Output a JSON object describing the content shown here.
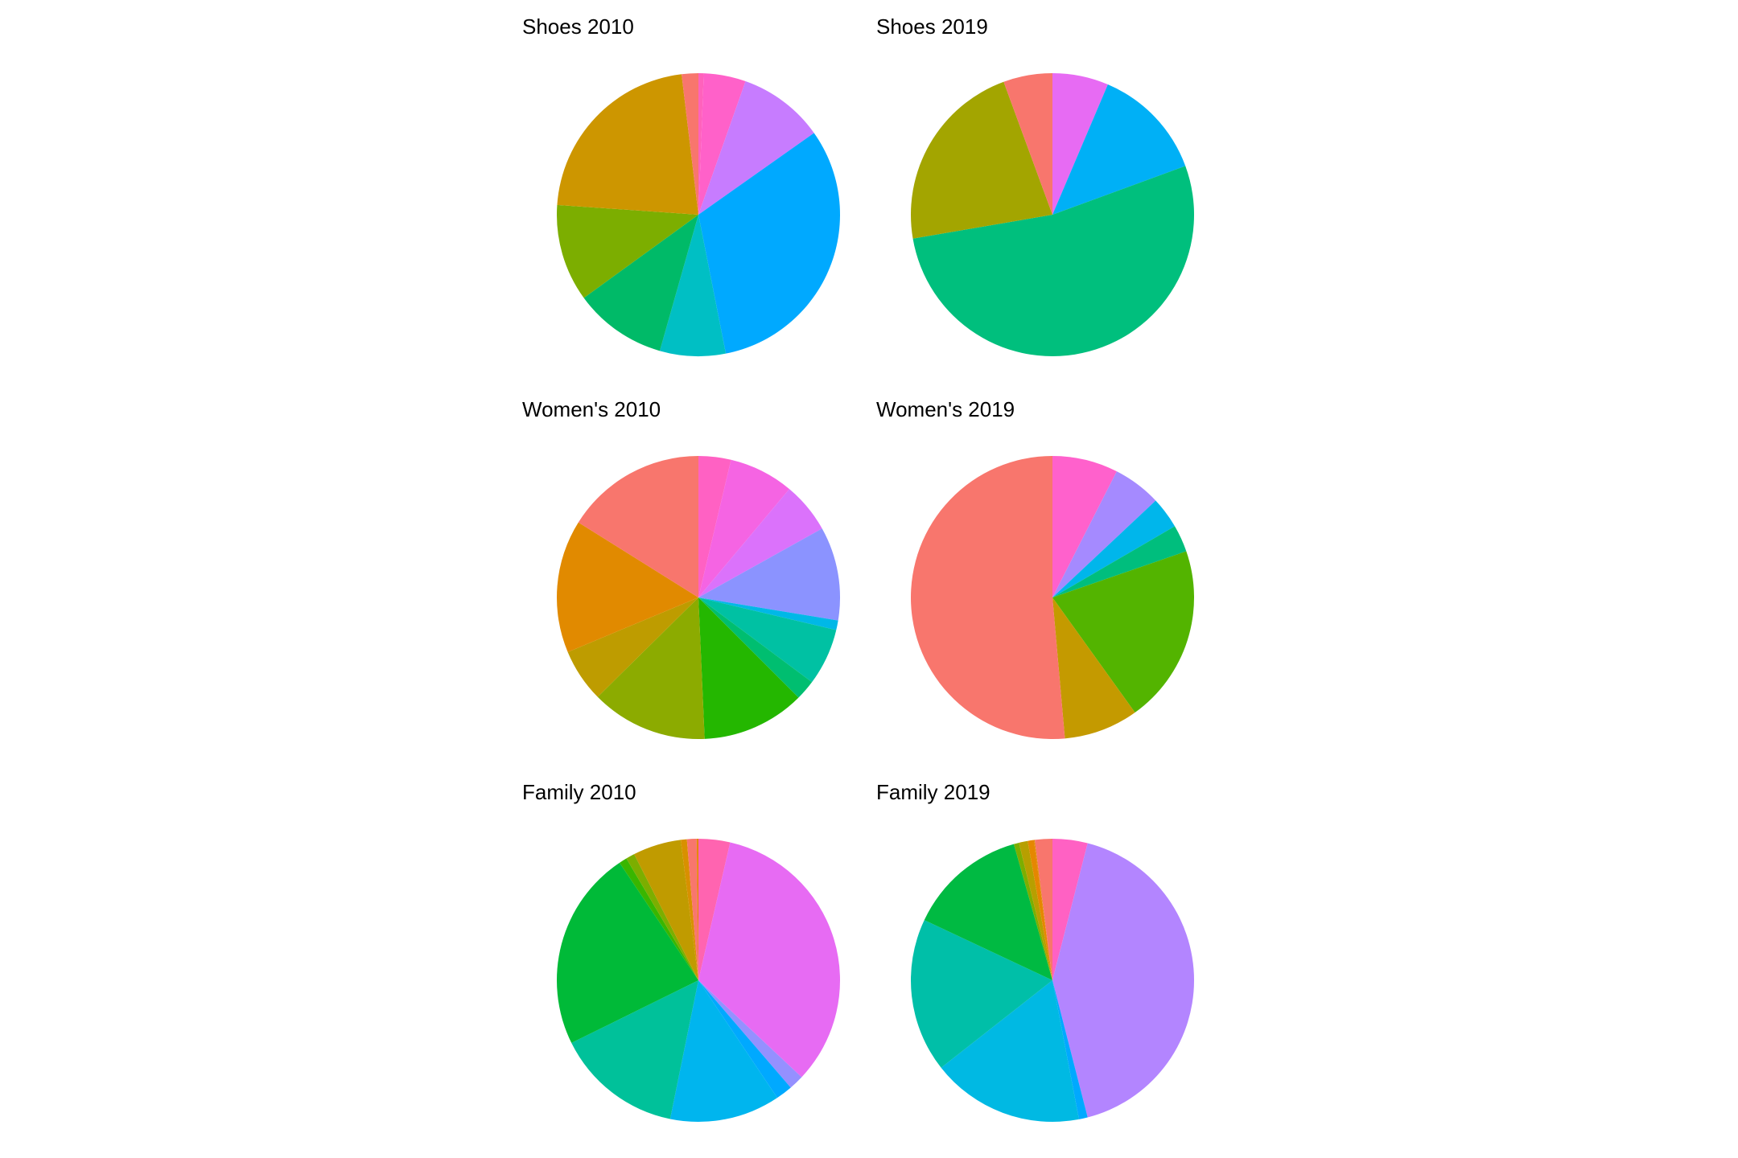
{
  "chart_data": [
    {
      "type": "pie",
      "title": "Shoes 2010",
      "slices": [
        {
          "value": 0.6,
          "color": "#FF62BC"
        },
        {
          "value": 4.8,
          "color": "#FF61C9"
        },
        {
          "value": 9.8,
          "color": "#C77CFF"
        },
        {
          "value": 31.7,
          "color": "#00A9FF"
        },
        {
          "value": 7.5,
          "color": "#00BFC4"
        },
        {
          "value": 10.6,
          "color": "#00BA68"
        },
        {
          "value": 11.1,
          "color": "#7CAE00"
        },
        {
          "value": 22.0,
          "color": "#CD9600"
        },
        {
          "value": 1.9,
          "color": "#F8766D"
        }
      ]
    },
    {
      "type": "pie",
      "title": "Shoes 2019",
      "slices": [
        {
          "value": 6.4,
          "color": "#E76BF3"
        },
        {
          "value": 13.0,
          "color": "#00B0F6"
        },
        {
          "value": 52.9,
          "color": "#00BF7D"
        },
        {
          "value": 22.1,
          "color": "#A3A500"
        },
        {
          "value": 5.6,
          "color": "#F8766D"
        }
      ]
    },
    {
      "type": "pie",
      "title": "Women's 2010",
      "slices": [
        {
          "value": 3.7,
          "color": "#FF61C3"
        },
        {
          "value": 7.4,
          "color": "#F564E3"
        },
        {
          "value": 5.8,
          "color": "#DB72FB"
        },
        {
          "value": 10.7,
          "color": "#8B93FF"
        },
        {
          "value": 1.1,
          "color": "#00B8E7"
        },
        {
          "value": 6.5,
          "color": "#00C1A3"
        },
        {
          "value": 2.3,
          "color": "#00BE70"
        },
        {
          "value": 11.8,
          "color": "#24B700"
        },
        {
          "value": 13.3,
          "color": "#8CAB00"
        },
        {
          "value": 6.1,
          "color": "#BE9C00"
        },
        {
          "value": 15.2,
          "color": "#E18A00"
        },
        {
          "value": 16.1,
          "color": "#F8766D"
        }
      ]
    },
    {
      "type": "pie",
      "title": "Women's 2019",
      "slices": [
        {
          "value": 7.5,
          "color": "#FF61CC"
        },
        {
          "value": 5.5,
          "color": "#A58AFF"
        },
        {
          "value": 3.6,
          "color": "#00B6EB"
        },
        {
          "value": 3.1,
          "color": "#00BE7D"
        },
        {
          "value": 20.4,
          "color": "#53B400"
        },
        {
          "value": 8.5,
          "color": "#C49A00"
        },
        {
          "value": 51.4,
          "color": "#F8766D"
        }
      ]
    },
    {
      "type": "pie",
      "title": "Family 2010",
      "slices": [
        {
          "value": 3.6,
          "color": "#FF64B0"
        },
        {
          "value": 33.4,
          "color": "#E76BF3"
        },
        {
          "value": 1.7,
          "color": "#9590FF"
        },
        {
          "value": 1.9,
          "color": "#00A9FF"
        },
        {
          "value": 12.6,
          "color": "#00B5EE"
        },
        {
          "value": 14.5,
          "color": "#00C19A"
        },
        {
          "value": 22.9,
          "color": "#00BA38"
        },
        {
          "value": 0.9,
          "color": "#39B600"
        },
        {
          "value": 1.0,
          "color": "#7CAE00"
        },
        {
          "value": 5.5,
          "color": "#C09B00"
        },
        {
          "value": 0.7,
          "color": "#D89000"
        },
        {
          "value": 1.1,
          "color": "#F8766D"
        },
        {
          "value": 0.2,
          "color": "#E58700"
        }
      ]
    },
    {
      "type": "pie",
      "title": "Family 2019",
      "slices": [
        {
          "value": 4.0,
          "color": "#FF61C3"
        },
        {
          "value": 42.0,
          "color": "#B385FF"
        },
        {
          "value": 1.0,
          "color": "#00A9FF"
        },
        {
          "value": 17.4,
          "color": "#00B9E3"
        },
        {
          "value": 17.6,
          "color": "#00BFA8"
        },
        {
          "value": 13.6,
          "color": "#00BA42"
        },
        {
          "value": 0.6,
          "color": "#7CAE00"
        },
        {
          "value": 1.0,
          "color": "#B79F00"
        },
        {
          "value": 0.7,
          "color": "#E58700"
        },
        {
          "value": 0.1,
          "color": "#DE8C00"
        },
        {
          "value": 2.0,
          "color": "#F8766D"
        }
      ]
    }
  ]
}
